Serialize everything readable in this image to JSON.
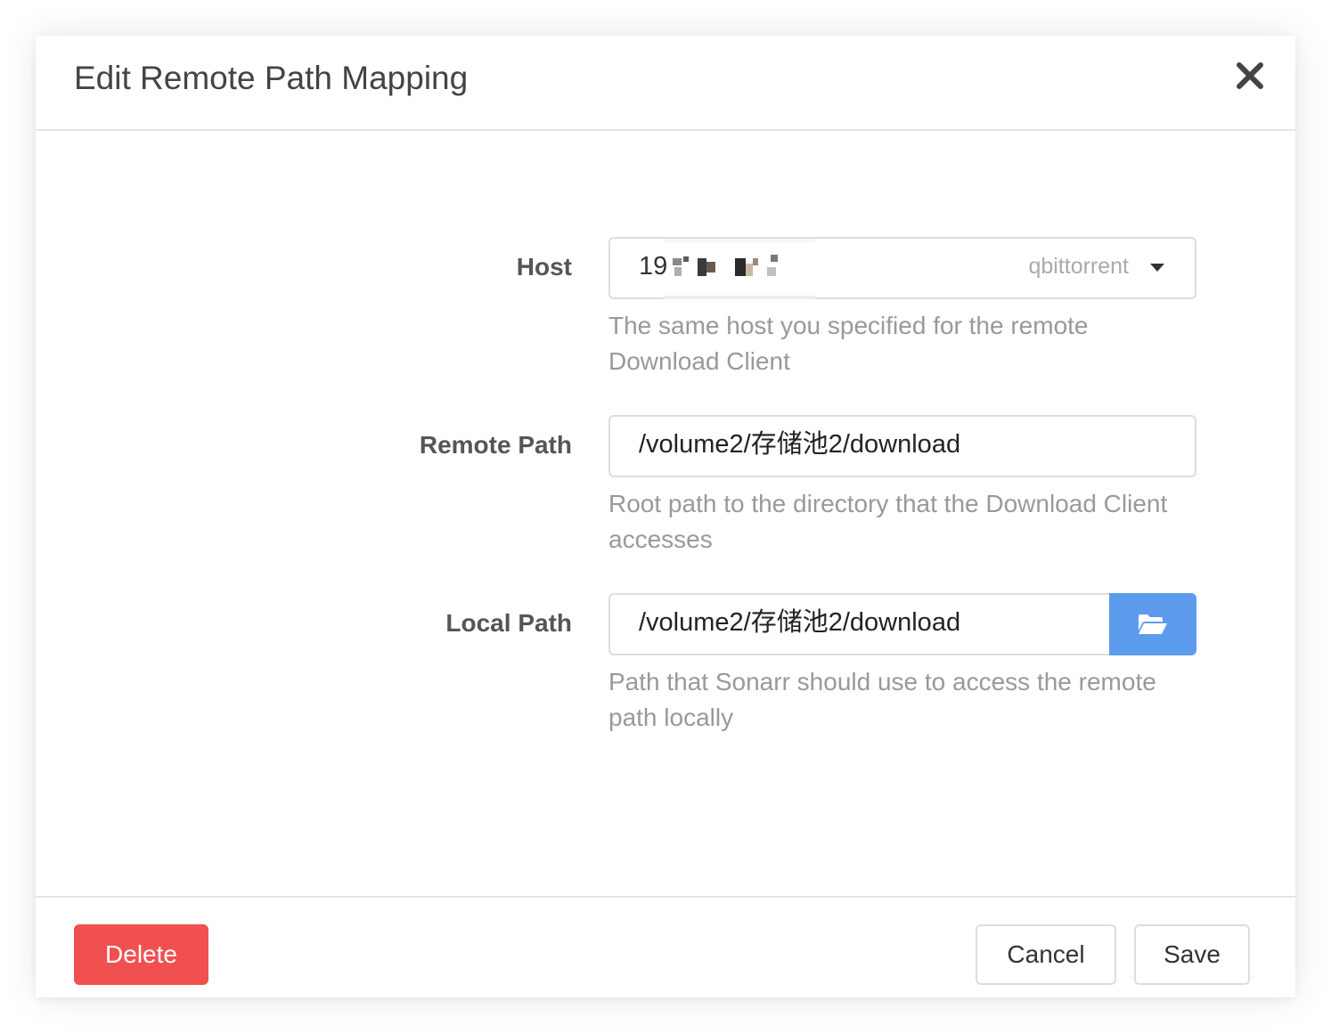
{
  "modal": {
    "title": "Edit Remote Path Mapping",
    "close_icon": "close-icon"
  },
  "host": {
    "label": "Host",
    "value_prefix": "19",
    "client": "qbittorrent",
    "dropdown_icon": "caret-down-icon",
    "help": "The same host you specified for the remote Download Client"
  },
  "remote_path": {
    "label": "Remote Path",
    "value": "/volume2/存储池2/download",
    "help": "Root path to the directory that the Download Client accesses"
  },
  "local_path": {
    "label": "Local Path",
    "value": "/volume2/存储池2/download",
    "browse_icon": "folder-open-icon",
    "help": "Path that Sonarr should use to access the remote path locally"
  },
  "footer": {
    "delete_label": "Delete",
    "cancel_label": "Cancel",
    "save_label": "Save"
  },
  "colors": {
    "danger": "#f05050",
    "primary": "#5d9cec",
    "label_text": "#555555",
    "help_text": "#999999"
  }
}
